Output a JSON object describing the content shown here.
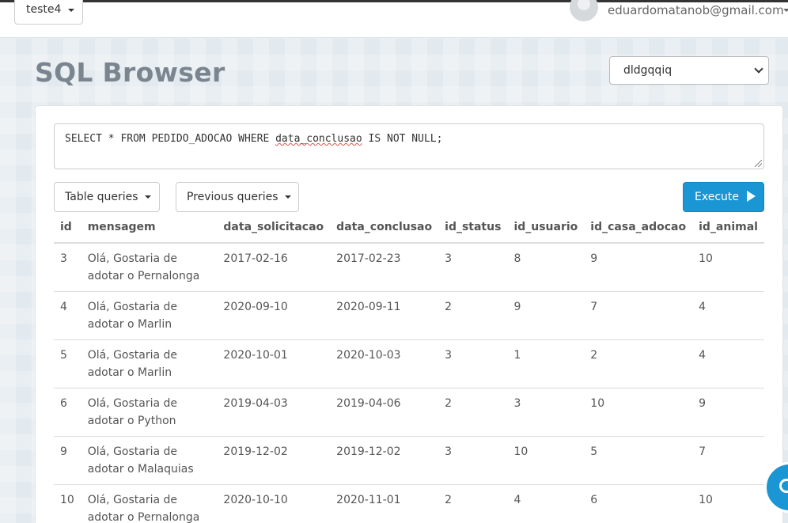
{
  "topbar": {
    "database_selector": "teste4",
    "user_email": "eduardomatanob@gmail.com"
  },
  "page": {
    "title": "SQL Browser",
    "schema_selected": "dldgqqiq"
  },
  "query": {
    "before": "SELECT * FROM PEDIDO_ADOCAO WHERE ",
    "underlined": "data_conclusao",
    "after": " IS NOT NULL;"
  },
  "toolbar": {
    "table_queries_label": "Table queries",
    "previous_queries_label": "Previous queries",
    "execute_label": "Execute"
  },
  "results": {
    "columns": [
      "id",
      "mensagem",
      "data_solicitacao",
      "data_conclusao",
      "id_status",
      "id_usuario",
      "id_casa_adocao",
      "id_animal"
    ],
    "rows": [
      [
        "3",
        "Olá, Gostaria de adotar o Pernalonga",
        "2017-02-16",
        "2017-02-23",
        "3",
        "8",
        "9",
        "10"
      ],
      [
        "4",
        "Olá, Gostaria de adotar o Marlin",
        "2020-09-10",
        "2020-09-11",
        "2",
        "9",
        "7",
        "4"
      ],
      [
        "5",
        "Olá, Gostaria de adotar o Marlin",
        "2020-10-01",
        "2020-10-03",
        "3",
        "1",
        "2",
        "4"
      ],
      [
        "6",
        "Olá, Gostaria de adotar o Python",
        "2019-04-03",
        "2019-04-06",
        "2",
        "3",
        "10",
        "9"
      ],
      [
        "9",
        "Olá, Gostaria de adotar o Malaquias",
        "2019-12-02",
        "2019-12-02",
        "3",
        "10",
        "5",
        "7"
      ],
      [
        "10",
        "Olá, Gostaria de adotar o Pernalonga",
        "2020-10-10",
        "2020-11-01",
        "2",
        "4",
        "6",
        "10"
      ]
    ]
  },
  "colors": {
    "accent": "#1a96d4",
    "title": "#7a8590",
    "spellcheck_underline": "#d9534f"
  },
  "icons": {
    "execute": "play-icon",
    "help": "help-icon"
  }
}
